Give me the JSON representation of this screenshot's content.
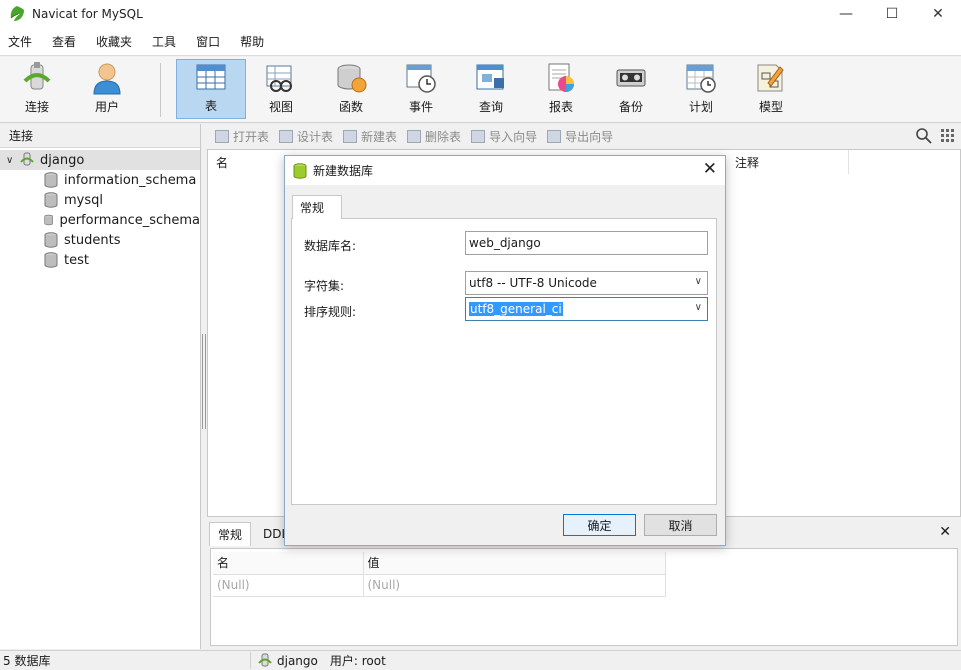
{
  "window": {
    "title": "Navicat for MySQL"
  },
  "menu": [
    "文件",
    "查看",
    "收藏夹",
    "工具",
    "窗口",
    "帮助"
  ],
  "toolbar": [
    {
      "label": "连接",
      "icon": "connection-icon"
    },
    {
      "label": "用户",
      "icon": "user-icon"
    },
    {
      "label": "表",
      "icon": "table-icon",
      "active": true
    },
    {
      "label": "视图",
      "icon": "view-icon"
    },
    {
      "label": "函数",
      "icon": "function-icon"
    },
    {
      "label": "事件",
      "icon": "event-icon"
    },
    {
      "label": "查询",
      "icon": "query-icon"
    },
    {
      "label": "报表",
      "icon": "report-icon"
    },
    {
      "label": "备份",
      "icon": "backup-icon"
    },
    {
      "label": "计划",
      "icon": "schedule-icon"
    },
    {
      "label": "模型",
      "icon": "model-icon"
    }
  ],
  "left_pane": {
    "header": "连接",
    "root": "django",
    "databases": [
      "information_schema",
      "mysql",
      "performance_schema",
      "students",
      "test"
    ]
  },
  "object_toolbar": [
    "打开表",
    "设计表",
    "新建表",
    "删除表",
    "导入向导",
    "导出向导"
  ],
  "grid": {
    "col_name": "名",
    "col_comment": "注释"
  },
  "bottom": {
    "tabs": [
      "常规",
      "DDL"
    ],
    "col_name": "名",
    "col_value": "值",
    "null_name": "(Null)",
    "null_value": "(Null)"
  },
  "status": {
    "db_count": "5 数据库",
    "connection": "django",
    "user": "用户: root"
  },
  "dialog": {
    "title": "新建数据库",
    "tab": "常规",
    "db_name_label": "数据库名:",
    "db_name_value": "web_django",
    "charset_label": "字符集:",
    "charset_value": "utf8 -- UTF-8 Unicode",
    "collation_label": "排序规则:",
    "collation_value": "utf8_general_ci",
    "ok": "确定",
    "cancel": "取消"
  }
}
